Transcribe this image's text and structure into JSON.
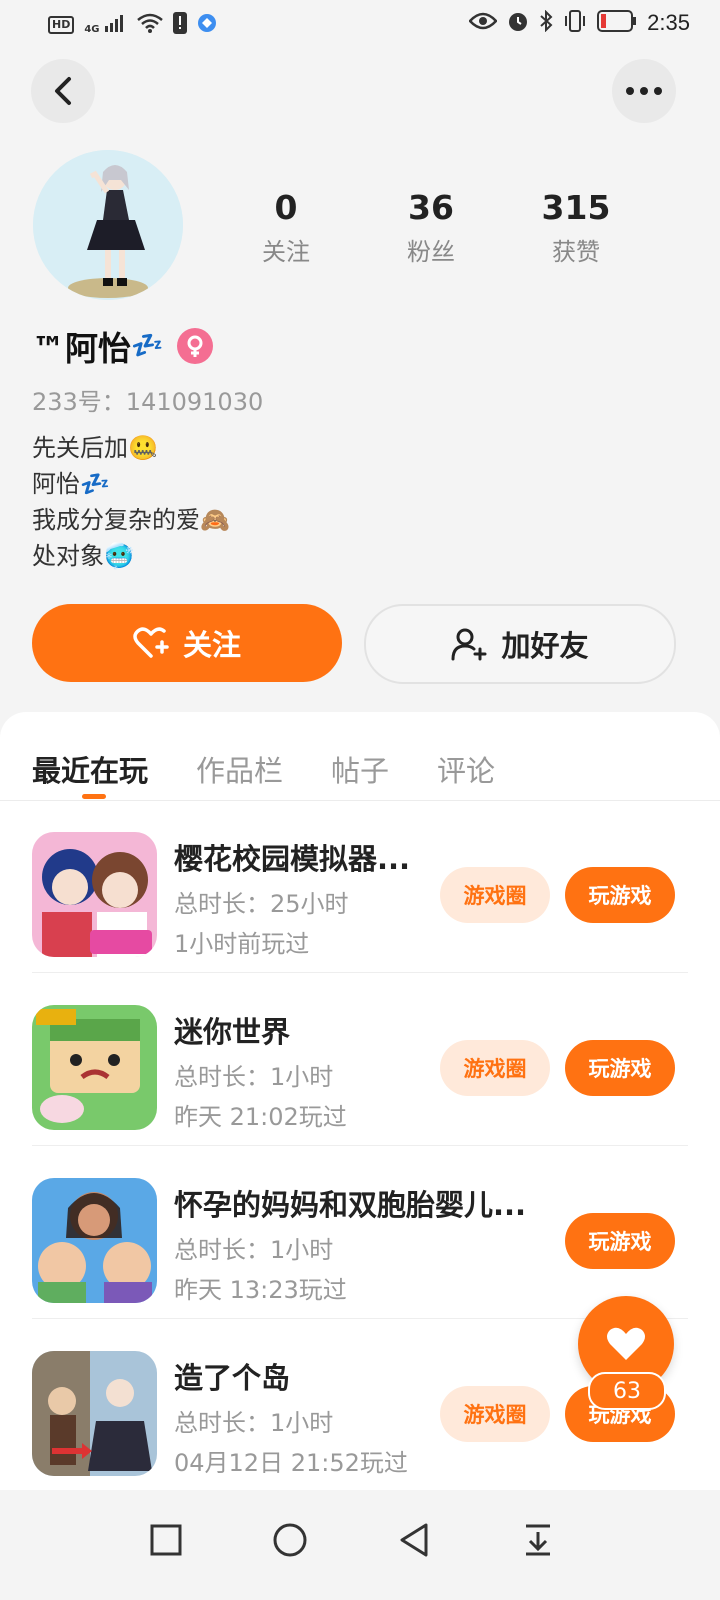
{
  "status_bar": {
    "hd": "HD",
    "network": "4G",
    "time": "2:35",
    "icons": [
      "hd-icon",
      "signal-icon",
      "wifi-icon",
      "alert-icon",
      "app-icon",
      "eye-icon",
      "alarm-icon",
      "bluetooth-icon",
      "vibrate-icon",
      "battery-icon"
    ]
  },
  "header": {
    "back_icon": "chevron-left-icon",
    "more_icon": "more-dots-icon"
  },
  "profile": {
    "stats": [
      {
        "value": "0",
        "label": "关注"
      },
      {
        "value": "36",
        "label": "粉丝"
      },
      {
        "value": "315",
        "label": "获赞"
      }
    ],
    "name": "™阿怡",
    "name_emoji": "💤",
    "gender": "female",
    "uid": "233号：141091030",
    "bio": [
      {
        "text": "先关后加",
        "emoji": "🤐"
      },
      {
        "text": "阿怡",
        "emoji": "💤"
      },
      {
        "text": "我成分复杂的爱",
        "emoji": "🙈"
      },
      {
        "text": "处对象",
        "emoji": "🥶"
      }
    ],
    "follow_label": "关注",
    "add_friend_label": "加好友"
  },
  "tabs": [
    {
      "label": "最近在玩",
      "active": true
    },
    {
      "label": "作品栏",
      "active": false
    },
    {
      "label": "帖子",
      "active": false
    },
    {
      "label": "评论",
      "active": false
    }
  ],
  "games": [
    {
      "title": "樱花校园模拟器...",
      "duration": "总时长：25小时",
      "last_played": "1小时前玩过",
      "circle_label": "游戏圈",
      "play_label": "玩游戏",
      "has_circle": true
    },
    {
      "title": "迷你世界",
      "duration": "总时长：1小时",
      "last_played": "昨天 21:02玩过",
      "circle_label": "游戏圈",
      "play_label": "玩游戏",
      "has_circle": true
    },
    {
      "title": "怀孕的妈妈和双胞胎婴儿...",
      "duration": "总时长：1小时",
      "last_played": "昨天 13:23玩过",
      "circle_label": "",
      "play_label": "玩游戏",
      "has_circle": false
    },
    {
      "title": "造了个岛",
      "duration": "总时长：1小时",
      "last_played": "04月12日 21:52玩过",
      "circle_label": "游戏圈",
      "play_label": "玩游戏",
      "has_circle": true
    }
  ],
  "like_fab": {
    "count": "63"
  },
  "colors": {
    "accent": "#ff7212",
    "accent_light": "#ffe9da",
    "gender_female": "#f46e92"
  }
}
